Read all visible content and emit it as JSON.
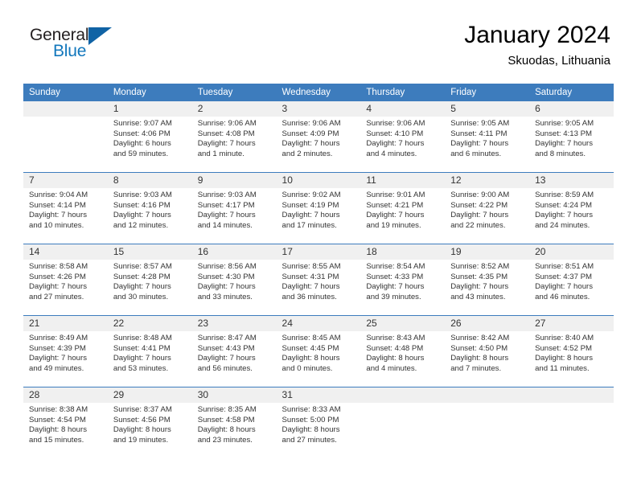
{
  "brand": {
    "name_part1": "General",
    "name_part2": "Blue",
    "color_dark": "#231f20",
    "color_blue": "#1277bc",
    "triangle_color": "#1063a5"
  },
  "header": {
    "title": "January 2024",
    "subtitle": "Skuodas, Lithuania"
  },
  "theme": {
    "header_bg": "#3d7cbd",
    "header_text": "#ffffff",
    "daynum_bg": "#f0f0f0",
    "body_text": "#333333"
  },
  "weekdays": [
    "Sunday",
    "Monday",
    "Tuesday",
    "Wednesday",
    "Thursday",
    "Friday",
    "Saturday"
  ],
  "weeks": [
    [
      {
        "day": "",
        "lines": []
      },
      {
        "day": "1",
        "lines": [
          "Sunrise: 9:07 AM",
          "Sunset: 4:06 PM",
          "Daylight: 6 hours",
          "and 59 minutes."
        ]
      },
      {
        "day": "2",
        "lines": [
          "Sunrise: 9:06 AM",
          "Sunset: 4:08 PM",
          "Daylight: 7 hours",
          "and 1 minute."
        ]
      },
      {
        "day": "3",
        "lines": [
          "Sunrise: 9:06 AM",
          "Sunset: 4:09 PM",
          "Daylight: 7 hours",
          "and 2 minutes."
        ]
      },
      {
        "day": "4",
        "lines": [
          "Sunrise: 9:06 AM",
          "Sunset: 4:10 PM",
          "Daylight: 7 hours",
          "and 4 minutes."
        ]
      },
      {
        "day": "5",
        "lines": [
          "Sunrise: 9:05 AM",
          "Sunset: 4:11 PM",
          "Daylight: 7 hours",
          "and 6 minutes."
        ]
      },
      {
        "day": "6",
        "lines": [
          "Sunrise: 9:05 AM",
          "Sunset: 4:13 PM",
          "Daylight: 7 hours",
          "and 8 minutes."
        ]
      }
    ],
    [
      {
        "day": "7",
        "lines": [
          "Sunrise: 9:04 AM",
          "Sunset: 4:14 PM",
          "Daylight: 7 hours",
          "and 10 minutes."
        ]
      },
      {
        "day": "8",
        "lines": [
          "Sunrise: 9:03 AM",
          "Sunset: 4:16 PM",
          "Daylight: 7 hours",
          "and 12 minutes."
        ]
      },
      {
        "day": "9",
        "lines": [
          "Sunrise: 9:03 AM",
          "Sunset: 4:17 PM",
          "Daylight: 7 hours",
          "and 14 minutes."
        ]
      },
      {
        "day": "10",
        "lines": [
          "Sunrise: 9:02 AM",
          "Sunset: 4:19 PM",
          "Daylight: 7 hours",
          "and 17 minutes."
        ]
      },
      {
        "day": "11",
        "lines": [
          "Sunrise: 9:01 AM",
          "Sunset: 4:21 PM",
          "Daylight: 7 hours",
          "and 19 minutes."
        ]
      },
      {
        "day": "12",
        "lines": [
          "Sunrise: 9:00 AM",
          "Sunset: 4:22 PM",
          "Daylight: 7 hours",
          "and 22 minutes."
        ]
      },
      {
        "day": "13",
        "lines": [
          "Sunrise: 8:59 AM",
          "Sunset: 4:24 PM",
          "Daylight: 7 hours",
          "and 24 minutes."
        ]
      }
    ],
    [
      {
        "day": "14",
        "lines": [
          "Sunrise: 8:58 AM",
          "Sunset: 4:26 PM",
          "Daylight: 7 hours",
          "and 27 minutes."
        ]
      },
      {
        "day": "15",
        "lines": [
          "Sunrise: 8:57 AM",
          "Sunset: 4:28 PM",
          "Daylight: 7 hours",
          "and 30 minutes."
        ]
      },
      {
        "day": "16",
        "lines": [
          "Sunrise: 8:56 AM",
          "Sunset: 4:30 PM",
          "Daylight: 7 hours",
          "and 33 minutes."
        ]
      },
      {
        "day": "17",
        "lines": [
          "Sunrise: 8:55 AM",
          "Sunset: 4:31 PM",
          "Daylight: 7 hours",
          "and 36 minutes."
        ]
      },
      {
        "day": "18",
        "lines": [
          "Sunrise: 8:54 AM",
          "Sunset: 4:33 PM",
          "Daylight: 7 hours",
          "and 39 minutes."
        ]
      },
      {
        "day": "19",
        "lines": [
          "Sunrise: 8:52 AM",
          "Sunset: 4:35 PM",
          "Daylight: 7 hours",
          "and 43 minutes."
        ]
      },
      {
        "day": "20",
        "lines": [
          "Sunrise: 8:51 AM",
          "Sunset: 4:37 PM",
          "Daylight: 7 hours",
          "and 46 minutes."
        ]
      }
    ],
    [
      {
        "day": "21",
        "lines": [
          "Sunrise: 8:49 AM",
          "Sunset: 4:39 PM",
          "Daylight: 7 hours",
          "and 49 minutes."
        ]
      },
      {
        "day": "22",
        "lines": [
          "Sunrise: 8:48 AM",
          "Sunset: 4:41 PM",
          "Daylight: 7 hours",
          "and 53 minutes."
        ]
      },
      {
        "day": "23",
        "lines": [
          "Sunrise: 8:47 AM",
          "Sunset: 4:43 PM",
          "Daylight: 7 hours",
          "and 56 minutes."
        ]
      },
      {
        "day": "24",
        "lines": [
          "Sunrise: 8:45 AM",
          "Sunset: 4:45 PM",
          "Daylight: 8 hours",
          "and 0 minutes."
        ]
      },
      {
        "day": "25",
        "lines": [
          "Sunrise: 8:43 AM",
          "Sunset: 4:48 PM",
          "Daylight: 8 hours",
          "and 4 minutes."
        ]
      },
      {
        "day": "26",
        "lines": [
          "Sunrise: 8:42 AM",
          "Sunset: 4:50 PM",
          "Daylight: 8 hours",
          "and 7 minutes."
        ]
      },
      {
        "day": "27",
        "lines": [
          "Sunrise: 8:40 AM",
          "Sunset: 4:52 PM",
          "Daylight: 8 hours",
          "and 11 minutes."
        ]
      }
    ],
    [
      {
        "day": "28",
        "lines": [
          "Sunrise: 8:38 AM",
          "Sunset: 4:54 PM",
          "Daylight: 8 hours",
          "and 15 minutes."
        ]
      },
      {
        "day": "29",
        "lines": [
          "Sunrise: 8:37 AM",
          "Sunset: 4:56 PM",
          "Daylight: 8 hours",
          "and 19 minutes."
        ]
      },
      {
        "day": "30",
        "lines": [
          "Sunrise: 8:35 AM",
          "Sunset: 4:58 PM",
          "Daylight: 8 hours",
          "and 23 minutes."
        ]
      },
      {
        "day": "31",
        "lines": [
          "Sunrise: 8:33 AM",
          "Sunset: 5:00 PM",
          "Daylight: 8 hours",
          "and 27 minutes."
        ]
      },
      {
        "day": "",
        "lines": []
      },
      {
        "day": "",
        "lines": []
      },
      {
        "day": "",
        "lines": []
      }
    ]
  ]
}
